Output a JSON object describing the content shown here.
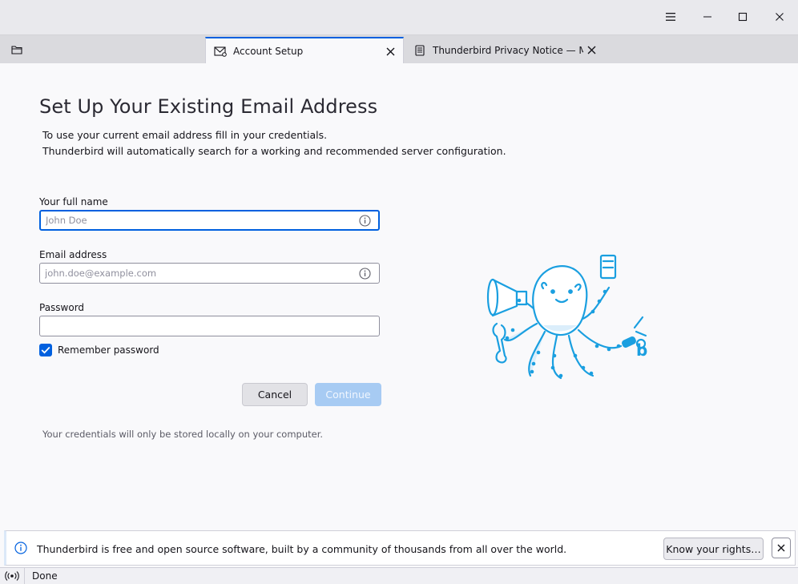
{
  "window": {
    "menu_icon": "hamburger-menu-icon",
    "minimize_icon": "minimize-icon",
    "maximize_icon": "maximize-icon",
    "close_icon": "close-icon"
  },
  "tabs": [
    {
      "label": "Account Setup",
      "icon": "envelope-gear-icon",
      "active": true
    },
    {
      "label": "Thunderbird Privacy Notice — Mozi",
      "icon": "document-icon",
      "active": false
    }
  ],
  "setup": {
    "title": "Set Up Your Existing Email Address",
    "intro_line1": "To use your current email address fill in your credentials.",
    "intro_line2": "Thunderbird will automatically search for a working and recommended server configuration.",
    "name_label": "Your full name",
    "name_placeholder": "John Doe",
    "name_value": "",
    "email_label": "Email address",
    "email_placeholder": "john.doe@example.com",
    "email_value": "",
    "password_label": "Password",
    "password_value": "",
    "remember_label": "Remember password",
    "remember_checked": true,
    "cancel_label": "Cancel",
    "continue_label": "Continue",
    "footnote": "Your credentials will only be stored locally on your computer."
  },
  "notification": {
    "icon": "info-icon",
    "text": "Thunderbird is free and open source software, built by a community of thousands from all over the world.",
    "button_label": "Know your rights…"
  },
  "status": {
    "icon": "online-status-icon",
    "text": "Done"
  },
  "colors": {
    "accent": "#0060df",
    "continue_disabled": "#a7cbf3",
    "illustration": "#1a9fe0"
  }
}
